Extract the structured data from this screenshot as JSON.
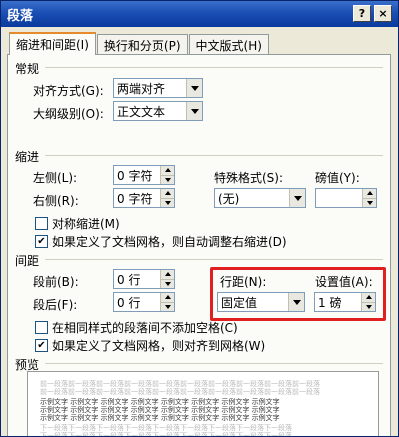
{
  "window": {
    "title": "段落",
    "help_btn": "?",
    "close_btn": "×"
  },
  "tabs": [
    {
      "label": "缩进和间距(I)"
    },
    {
      "label": "换行和分页(P)"
    },
    {
      "label": "中文版式(H)"
    }
  ],
  "general": {
    "section": "常规",
    "align_label": "对齐方式(G):",
    "align_value": "两端对齐",
    "outline_label": "大纲级别(O):",
    "outline_value": "正文文本"
  },
  "indent": {
    "section": "缩进",
    "left_label": "左侧(L):",
    "left_value": "0 字符",
    "right_label": "右侧(R):",
    "right_value": "0 字符",
    "special_label": "特殊格式(S):",
    "special_value": "(无)",
    "by_label": "磅值(Y):",
    "by_value": "",
    "mirror_label": "对称缩进(M)",
    "mirror_checked": false,
    "auto_adjust_label": "如果定义了文档网格，则自动调整右缩进(D)",
    "auto_adjust_checked": true
  },
  "spacing": {
    "section": "间距",
    "before_label": "段前(B):",
    "before_value": "0 行",
    "after_label": "段后(F):",
    "after_value": "0 行",
    "line_label": "行距(N):",
    "line_value": "固定值",
    "at_label": "设置值(A):",
    "at_value": "1 磅",
    "no_space_label": "在相同样式的段落间不添加空格(C)",
    "no_space_checked": false,
    "snap_label": "如果定义了文档网格，则对齐到网格(W)",
    "snap_checked": true
  },
  "preview": {
    "section": "预览",
    "prev_text": "前一段落前一段落前一段落前一段落前一段落前一段落前一段落前一段落前一段落前一段落",
    "sample_text": "示例文字 示例文字 示例文字 示例文字 示例文字 示例文字 示例文字 示例文字",
    "next_text": "下一段落下一段落下一段落下一段落下一段落下一段落下一段落下一段落下一段落"
  }
}
